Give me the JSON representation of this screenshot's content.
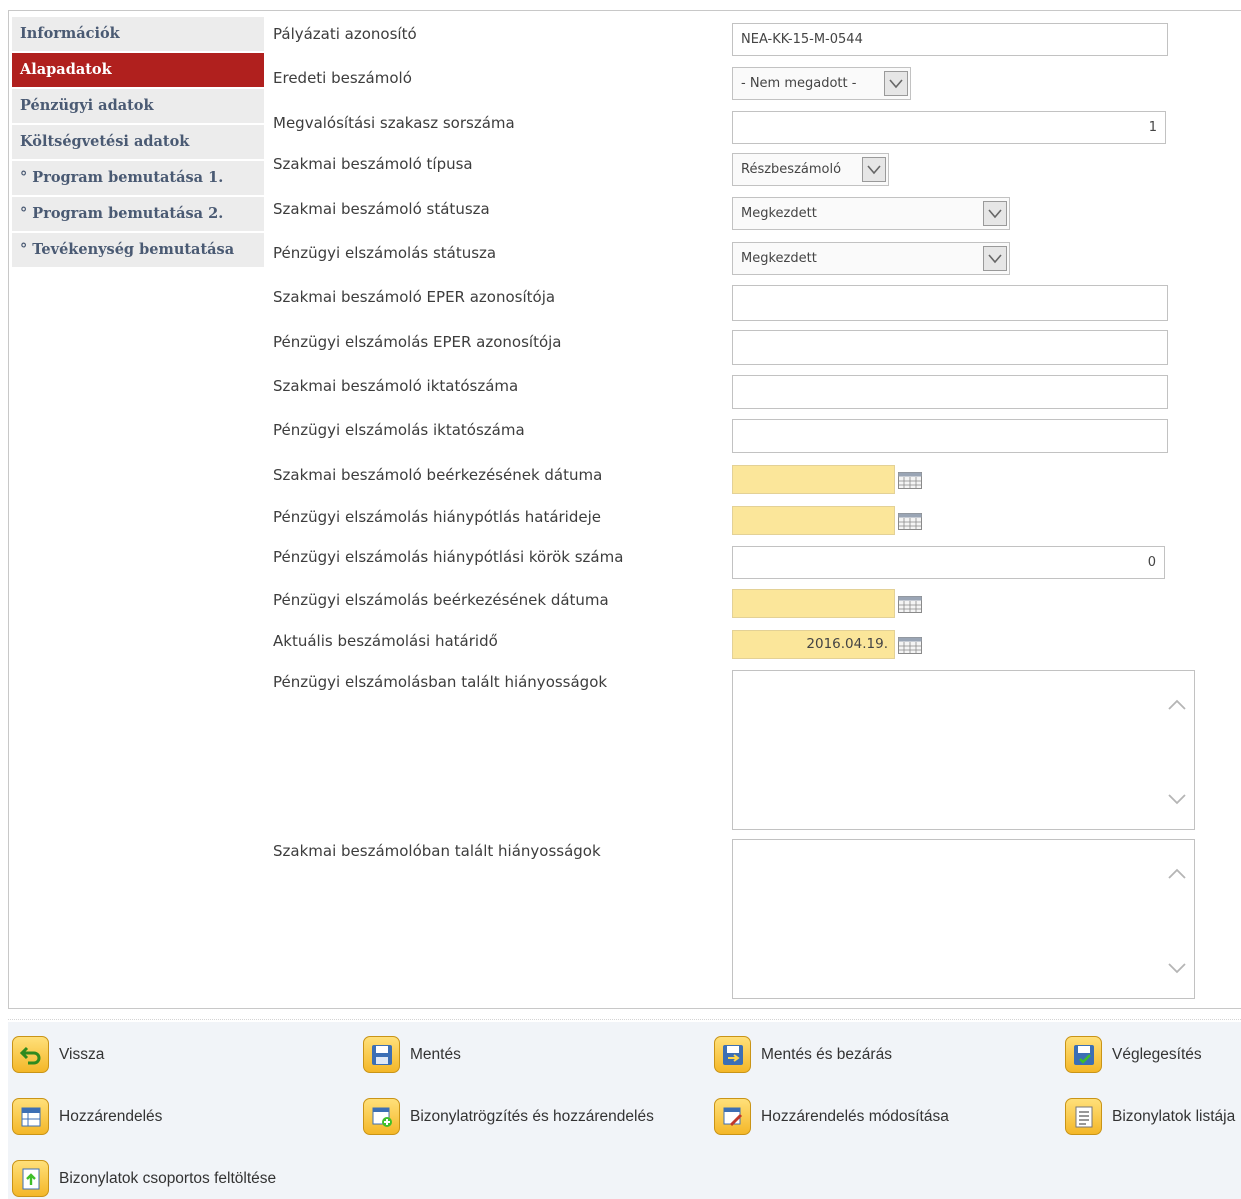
{
  "sidebar": {
    "items": [
      {
        "label": "Információk"
      },
      {
        "label": "Alapadatok"
      },
      {
        "label": "Pénzügyi adatok"
      },
      {
        "label": "Költségvetési adatok"
      },
      {
        "label": "° Program bemutatása 1."
      },
      {
        "label": "° Program bemutatása 2."
      },
      {
        "label": "° Tevékenység bemutatása"
      }
    ],
    "active_index": 1
  },
  "form": {
    "palyazati_azonosito": {
      "label": "Pályázati azonosító",
      "value": "NEA-KK-15-M-0544"
    },
    "eredeti_beszamolo": {
      "label": "Eredeti beszámoló",
      "value": "- Nem megadott -"
    },
    "megvalositasi_szakasz": {
      "label": "Megvalósítási szakasz sorszáma",
      "value": "1"
    },
    "szakmai_tipus": {
      "label": "Szakmai beszámoló típusa",
      "value": "Részbeszámoló"
    },
    "szakmai_statusz": {
      "label": "Szakmai beszámoló státusza",
      "value": "Megkezdett"
    },
    "penzugyi_statusz": {
      "label": "Pénzügyi elszámolás státusza",
      "value": "Megkezdett"
    },
    "szakmai_eper": {
      "label": "Szakmai beszámoló EPER azonosítója",
      "value": ""
    },
    "penzugyi_eper": {
      "label": "Pénzügyi elszámolás EPER azonosítója",
      "value": ""
    },
    "szakmai_iktato": {
      "label": "Szakmai beszámoló iktatószáma",
      "value": ""
    },
    "penzugyi_iktato": {
      "label": "Pénzügyi elszámolás iktatószáma",
      "value": ""
    },
    "szakmai_beerkezes": {
      "label": "Szakmai beszámoló beérkezésének dátuma",
      "value": ""
    },
    "penzugyi_hianypotlas_hatarido": {
      "label": "Pénzügyi elszámolás hiánypótlás határideje",
      "value": ""
    },
    "penzugyi_hianypotlasi_korok": {
      "label": "Pénzügyi elszámolás hiánypótlási körök száma",
      "value": "0"
    },
    "penzugyi_beerkezes": {
      "label": "Pénzügyi elszámolás beérkezésének dátuma",
      "value": ""
    },
    "aktualis_hatarido": {
      "label": "Aktuális beszámolási határidő",
      "value": "2016.04.19."
    },
    "penzugyi_hianyossagok": {
      "label": "Pénzügyi elszámolásban talált hiányosságok",
      "value": ""
    },
    "szakmai_hianyossagok": {
      "label": "Szakmai beszámolóban talált hiányosságok",
      "value": ""
    }
  },
  "toolbar": {
    "vissza": "Vissza",
    "mentes": "Mentés",
    "mentes_bezaras": "Mentés és bezárás",
    "veglegesites": "Véglegesítés",
    "hozzarendeles": "Hozzárendelés",
    "bizonylatrogzites": "Bizonylatrögzítés és hozzárendelés",
    "hozzarendeles_modositasa": "Hozzárendelés módosítása",
    "bizonylatok_listaja": "Bizonylatok listája",
    "csoportos_feltoltes": "Bizonylatok csoportos feltöltése"
  },
  "colors": {
    "accent": "#b0201e",
    "date_field": "#fbe69a",
    "toolbar_bg": "#f1f4f8"
  }
}
